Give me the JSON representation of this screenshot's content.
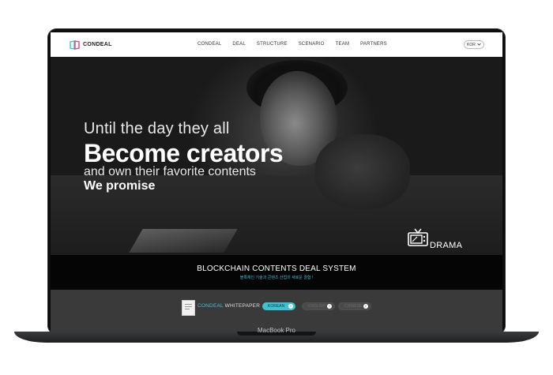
{
  "device": {
    "model_label": "MacBook Pro"
  },
  "nav": {
    "logo_text": "CONDEAL",
    "menu": [
      "CONDEAL",
      "DEAL",
      "STRUCTURE",
      "SCENARIO",
      "TEAM",
      "PARTNERS"
    ],
    "lang": "KOR"
  },
  "hero": {
    "line1": "Until the day they all",
    "line2": "Become creators",
    "line3": "and own their favorite contents",
    "line4": "We promise",
    "badge": "DRAMA"
  },
  "band": {
    "title": "BLOCKCHAIN CONTENTS DEAL SYSTEM",
    "subtitle": "블록체인 기술과 콘텐츠 산업의 새로운 결합 !"
  },
  "whitepaper": {
    "brand": "CONDEAL",
    "label": "WHITEPAPER",
    "buttons": [
      "KOREAN",
      "ENGLISH",
      "CHINESE"
    ]
  },
  "colors": {
    "accent": "#3ec2d1"
  }
}
